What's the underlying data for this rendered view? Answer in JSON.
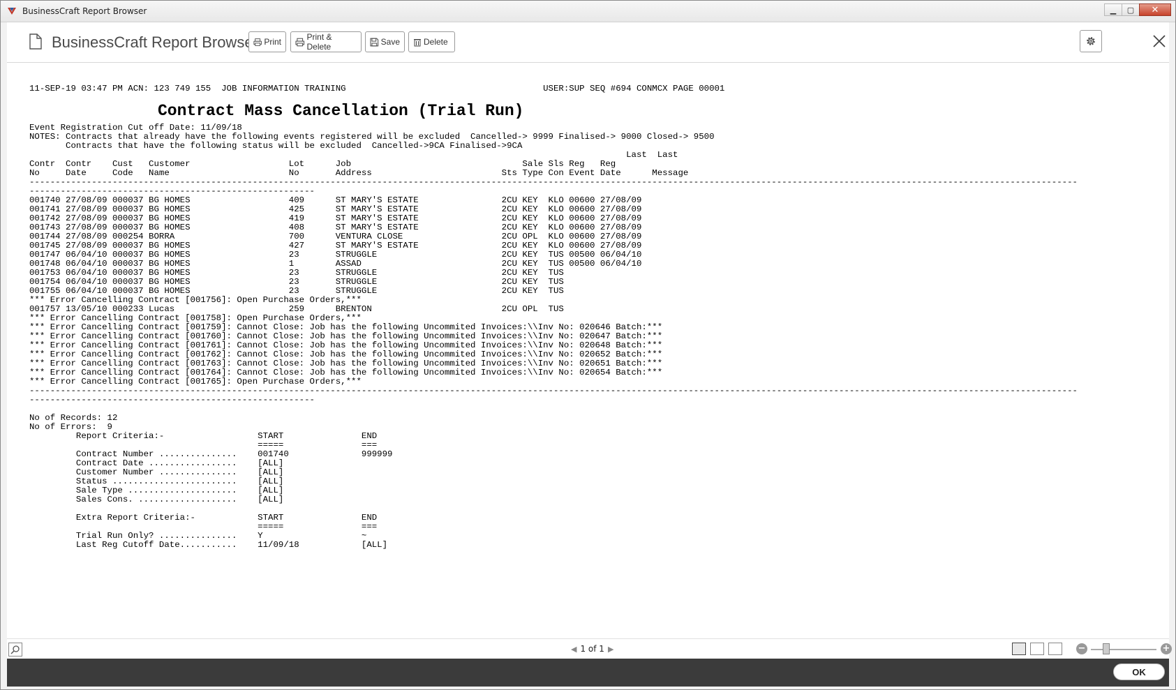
{
  "window": {
    "title": "BusinessCraft Report Browser",
    "minimize": "▁",
    "maximize": "▢",
    "close": "✕"
  },
  "toolbar": {
    "app_title": "BusinessCraft Report Browser",
    "print": "Print",
    "print_delete": "Print & Delete",
    "save": "Save",
    "delete": "Delete",
    "close": "✕"
  },
  "report": {
    "lines": [
      "11-SEP-19 03:47 PM ACN: 123 749 155  JOB INFORMATION TRAINING                                      USER:SUP SEQ #694 CONMCX PAGE 00001",
      "",
      "",
      "",
      "",
      "Event Registration Cut off Date: 11/09/18",
      "NOTES: Contracts that already have the following events registered will be excluded  Cancelled-> 9999 Finalised-> 9000 Closed-> 9500",
      "       Contracts that have the following status will be excluded  Cancelled->9CA Finalised->9CA",
      "                                                                                                                   Last  Last",
      "Contr  Contr    Cust   Customer                   Lot      Job                                 Sale Sls Reg   Reg",
      "No     Date     Code   Name                       No       Address                         Sts Type Con Event Date      Message",
      "----------------------------------------------------------------------------------------------------------------------------------------------------------------------------------------------------------",
      "-------------------------------------------------------",
      "001740 27/08/09 000037 BG HOMES                   409      ST MARY'S ESTATE                2CU KEY  KLO 00600 27/08/09",
      "001741 27/08/09 000037 BG HOMES                   425      ST MARY'S ESTATE                2CU KEY  KLO 00600 27/08/09",
      "001742 27/08/09 000037 BG HOMES                   419      ST MARY'S ESTATE                2CU KEY  KLO 00600 27/08/09",
      "001743 27/08/09 000037 BG HOMES                   408      ST MARY'S ESTATE                2CU KEY  KLO 00600 27/08/09",
      "001744 27/08/09 000254 BORRA                      700      VENTURA CLOSE                   2CU OPL  KLO 00600 27/08/09",
      "001745 27/08/09 000037 BG HOMES                   427      ST MARY'S ESTATE                2CU KEY  KLO 00600 27/08/09",
      "001747 06/04/10 000037 BG HOMES                   23       STRUGGLE                        2CU KEY  TUS 00500 06/04/10",
      "001748 06/04/10 000037 BG HOMES                   1        ASSAD                           2CU KEY  TUS 00500 06/04/10",
      "001753 06/04/10 000037 BG HOMES                   23       STRUGGLE                        2CU KEY  TUS",
      "001754 06/04/10 000037 BG HOMES                   23       STRUGGLE                        2CU KEY  TUS",
      "001755 06/04/10 000037 BG HOMES                   23       STRUGGLE                        2CU KEY  TUS",
      "*** Error Cancelling Contract [001756]: Open Purchase Orders,***",
      "001757 13/05/10 000233 Lucas                      259      BRENTON                         2CU OPL  TUS",
      "*** Error Cancelling Contract [001758]: Open Purchase Orders,***",
      "*** Error Cancelling Contract [001759]: Cannot Close: Job has the following Uncommited Invoices:\\\\Inv No: 020646 Batch:***",
      "*** Error Cancelling Contract [001760]: Cannot Close: Job has the following Uncommited Invoices:\\\\Inv No: 020647 Batch:***",
      "*** Error Cancelling Contract [001761]: Cannot Close: Job has the following Uncommited Invoices:\\\\Inv No: 020648 Batch:***",
      "*** Error Cancelling Contract [001762]: Cannot Close: Job has the following Uncommited Invoices:\\\\Inv No: 020652 Batch:***",
      "*** Error Cancelling Contract [001763]: Cannot Close: Job has the following Uncommited Invoices:\\\\Inv No: 020651 Batch:***",
      "*** Error Cancelling Contract [001764]: Cannot Close: Job has the following Uncommited Invoices:\\\\Inv No: 020654 Batch:***",
      "*** Error Cancelling Contract [001765]: Open Purchase Orders,***",
      "----------------------------------------------------------------------------------------------------------------------------------------------------------------------------------------------------------",
      "-------------------------------------------------------",
      "",
      "No of Records: 12",
      "No of Errors:  9",
      "         Report Criteria:-                  START               END",
      "                                            =====               ===",
      "         Contract Number ...............    001740              999999",
      "         Contract Date .................    [ALL]",
      "         Customer Number ...............    [ALL]",
      "         Status ........................    [ALL]",
      "         Sale Type .....................    [ALL]",
      "         Sales Cons. ...................    [ALL]",
      "",
      "         Extra Report Criteria:-            START               END",
      "                                            =====               ===",
      "         Trial Run Only? ...............    Y                   ~",
      "         Last Reg Cutoff Date...........    11/09/18            [ALL]"
    ],
    "title": "Contract Mass Cancellation (Trial Run)"
  },
  "status": {
    "pager": "1 of 1",
    "prev": "◀",
    "next": "▶",
    "zoom_minus": "−",
    "zoom_plus": "+"
  },
  "footer": {
    "ok": "OK"
  },
  "colors": {
    "footer_bg": "#3b3b3b",
    "close_btn": "#c7432b"
  }
}
